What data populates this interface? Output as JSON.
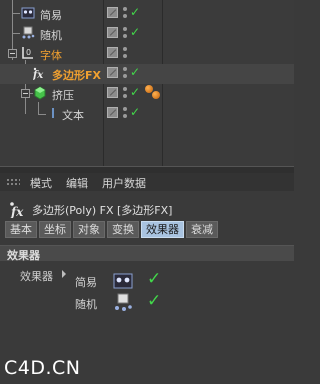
{
  "objects": [
    {
      "label": "简易",
      "style": "normal"
    },
    {
      "label": "随机",
      "style": "normal"
    },
    {
      "label": "字体",
      "style": "orange"
    },
    {
      "label": "多边形FX",
      "style": "orange-bold"
    },
    {
      "label": "挤压",
      "style": "normal"
    },
    {
      "label": "文本",
      "style": "normal"
    }
  ],
  "attr": {
    "menu": [
      "模式",
      "编辑",
      "用户数据"
    ],
    "title": "多边形(Poly) FX [多边形FX]",
    "tabs": [
      "基本",
      "坐标",
      "对象",
      "变换",
      "效果器",
      "衰减"
    ],
    "active_tab": "效果器",
    "section": "效果器",
    "field_label": "效果器",
    "effectors": [
      {
        "name": "简易",
        "icon": "simple-effector-icon",
        "enabled": true
      },
      {
        "name": "随机",
        "icon": "random-effector-icon",
        "enabled": true
      }
    ]
  },
  "check_glyph": "✓",
  "watermark": "C4D.CN",
  "colors": {
    "accent_tab": "#a9c3e0",
    "check": "#42d84a",
    "orange_label": "#f0a030"
  }
}
